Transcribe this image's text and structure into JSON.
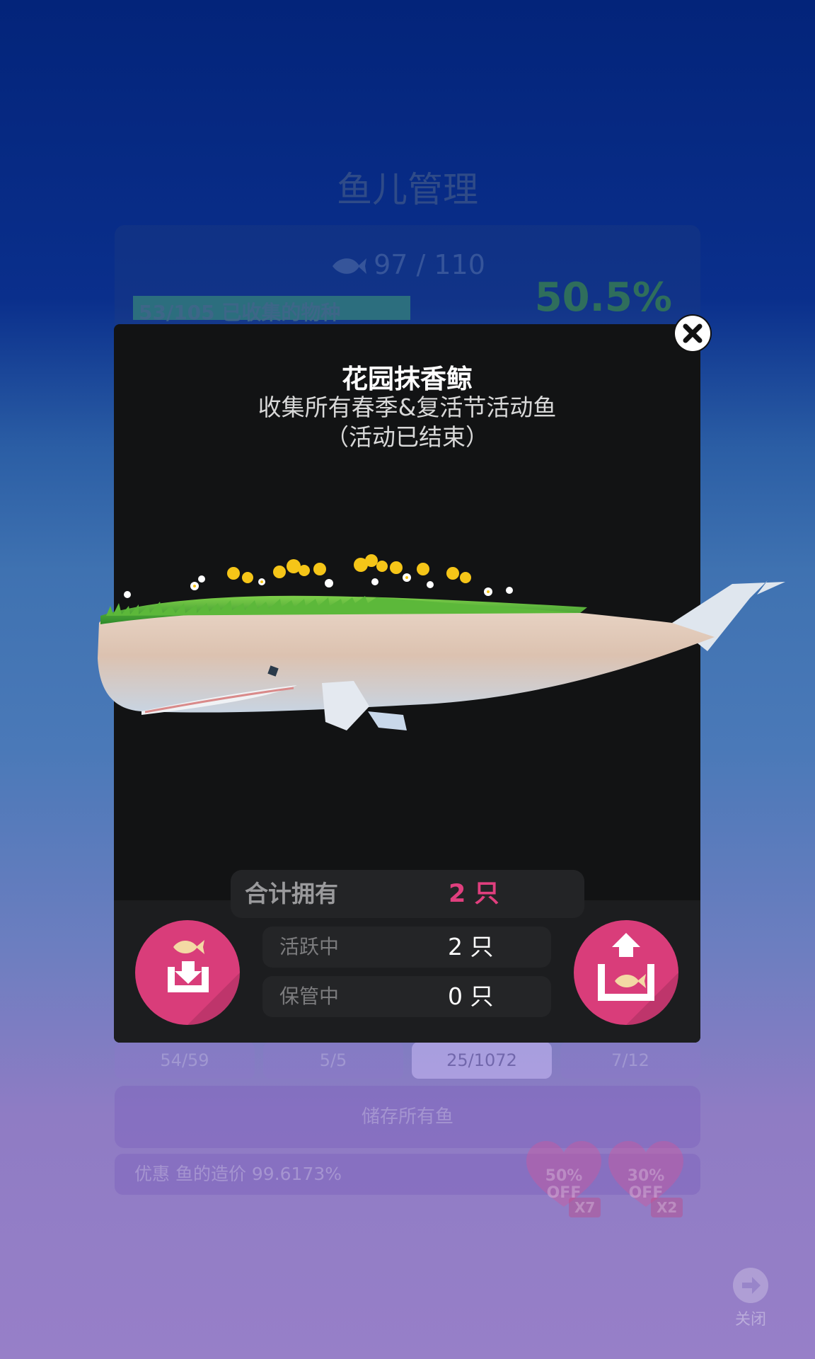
{
  "background": {
    "title": "鱼儿管理",
    "fish_count": "97 / 110",
    "collected_species": "53/105 已收集的物种",
    "collection_percent": "50.5%",
    "tabs": [
      "54/59",
      "5/5",
      "25/1072",
      "7/12"
    ],
    "active_tab_index": 2,
    "store_all_label": "储存所有鱼",
    "discount_text": "优惠 鱼的造价 99.6173%",
    "coupons": [
      {
        "line1": "50%",
        "line2": "OFF",
        "multiplier": "X7"
      },
      {
        "line1": "30%",
        "line2": "OFF",
        "multiplier": "X2"
      }
    ],
    "close_label": "关闭"
  },
  "modal": {
    "fish_name": "花园抹香鲸",
    "description": "收集所有春季&复活节活动鱼\n（活动已结束）",
    "total_label": "合计拥有",
    "total_value": "2 只",
    "active_label": "活跃中",
    "active_value": "2 只",
    "stored_label": "保管中",
    "stored_value": "0 只"
  },
  "colors": {
    "accent": "#d93d7a",
    "modal_bg": "#121314",
    "total_value": "#e03f7e"
  },
  "icons": {
    "close": "close-icon",
    "store": "store-fish-icon",
    "release": "release-fish-icon",
    "nav_close": "arrow-right-circle-icon"
  }
}
